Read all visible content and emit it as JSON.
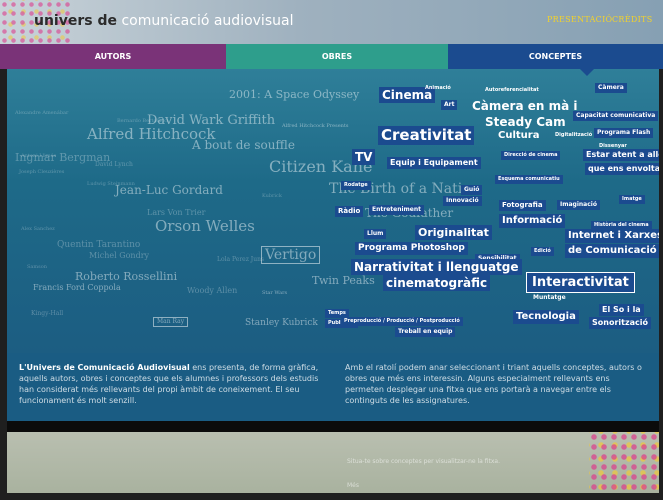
{
  "header": {
    "logo_part1": "univers de",
    "logo_part2": "comunicació audiovisual",
    "links": [
      "PRESENTACIÓ",
      "CRÈDITS"
    ]
  },
  "tabs": [
    "AUTORS",
    "OBRES",
    "CONCEPTES"
  ],
  "colors": {
    "autors": "#7a3378",
    "obres": "#2e9e8c",
    "conceptes": "#1b4b8f",
    "link": "#f2d22b"
  },
  "cloud": {
    "dim": [
      "Alexandre Amenábar",
      "Bernardo Bertolucci",
      "Alfred Hitchcock",
      "Antoni Llimós",
      "David Lynch",
      "Ingmar Bergman",
      "Joseph Cleuzières",
      "Ludwig Steinmann",
      "Lars Von Trier",
      "Alex Sanchez",
      "Kubrick",
      "Quentin Tarantino",
      "Michel Gondry",
      "Woody Allen",
      "Lola Perez Juns",
      "Samson",
      "Kingy-Hall"
    ],
    "mid": [
      "2001: A Space Odyssey",
      "David Wark Griffith",
      "A bout de souffle",
      "Citizen Kane",
      "Jean-Luc Gordard",
      "Orson Welles",
      "The Birth of a Nation",
      "The Godfather",
      "Vertigo",
      "Roberto Rossellini",
      "Francis Ford Coppola",
      "Twin Peaks",
      "Stanley Kubrick",
      "Alfred Hitchcock Presents",
      "Man Ray",
      "Star Wars"
    ],
    "concepts": [
      "Cinema",
      "Animació",
      "Art",
      "Autoreferencialitat",
      "Càmera",
      "Càmera en mà i",
      "Steady Cam",
      "Capacitat comunicativa",
      "Creativitat",
      "Cultura",
      "Digitalització",
      "Programa Flash",
      "Dissenyar",
      "TV",
      "Equip i Equipament",
      "Direcció de cinema",
      "Estar atent a allò",
      "que ens envolta",
      "Rodatge",
      "Guió",
      "Innovació",
      "Esquema comunicatiu",
      "Ràdio",
      "Entreteniment",
      "Fotografia",
      "Imaginació",
      "Imatge",
      "Llum",
      "Originalitat",
      "Informació",
      "Història del cinema",
      "Internet i Xarxes",
      "de Comunicació",
      "Programa Photoshop",
      "Edició",
      "Sensibilitat",
      "Narrativitat i llenguatge",
      "cinematogràfic",
      "Interactivitat",
      "Muntatge",
      "Temps",
      "Publicitat",
      "Tecnologia",
      "El So i la",
      "Sonorització",
      "Preproducció / Producció / Postproducció",
      "Treball en equip"
    ]
  },
  "info": {
    "left_hl": "L'Univers de Comunicació Audiovisual",
    "left": "ens presenta, de forma gràfica, aquells autors, obres i conceptes que els alumnes i professors dels estudis han considerat més rellevants del propi àmbit de coneixement. El seu funcionament és molt senzill.",
    "right": "Amb el ratolí podem anar seleccionant i triant aquells conceptes, autors o obres que més ens interessin. Alguns especialment rellevants ens permeten desplegar una fitxa que ens portarà a navegar entre els continguts de les assignatures."
  },
  "footer": {
    "line1": "Situa-te sobre conceptes per visualitzar-ne la fitxa.",
    "line2": "Més"
  }
}
